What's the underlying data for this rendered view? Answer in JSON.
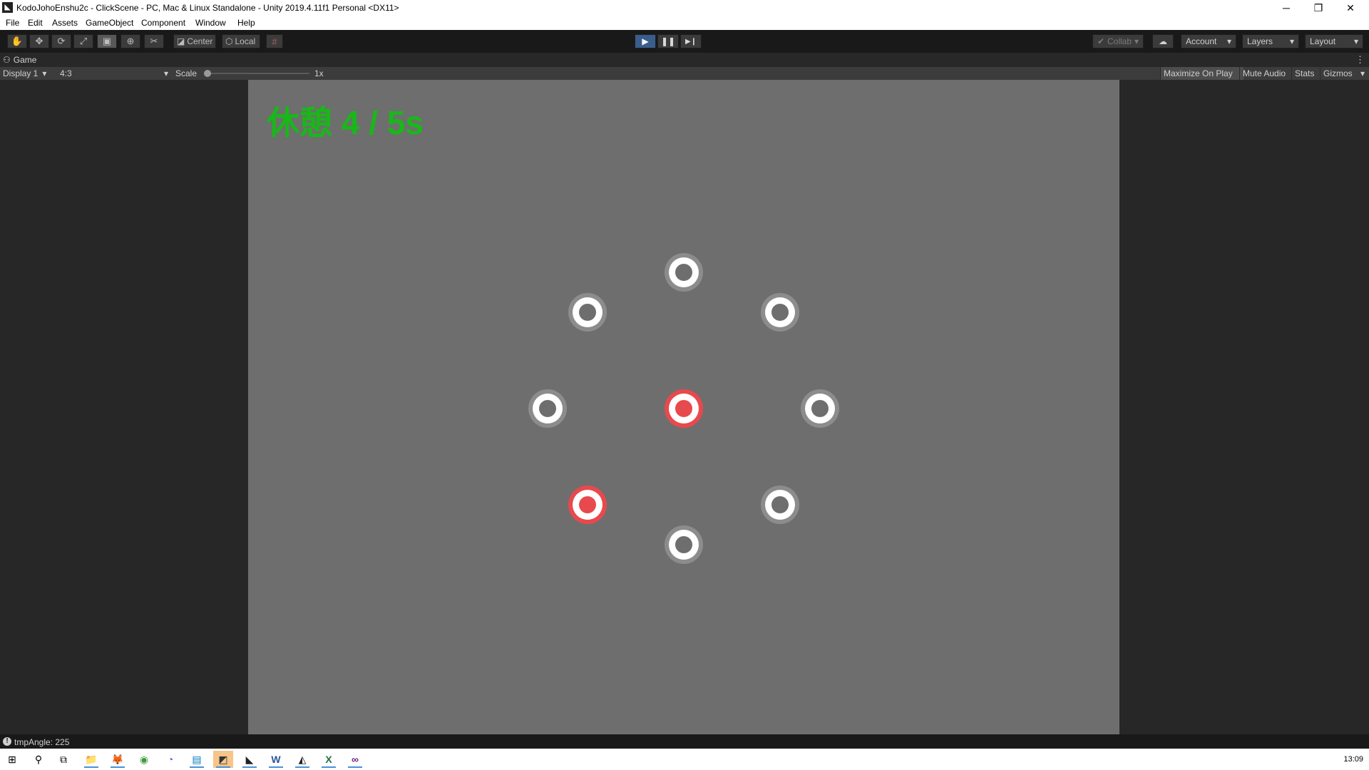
{
  "window": {
    "icon_glyph": "◣",
    "title": "KodoJohoEnshu2c - ClickScene - PC, Mac & Linux Standalone - Unity 2019.4.11f1 Personal <DX11>",
    "controls": {
      "minimize": "─",
      "restore": "❐",
      "close": "✕"
    }
  },
  "menu": [
    "File",
    "Edit",
    "Assets",
    "GameObject",
    "Component",
    "Window",
    "Help"
  ],
  "toolbar": {
    "tools": [
      {
        "name": "hand-tool-icon",
        "glyph": "✋"
      },
      {
        "name": "move-tool-icon",
        "glyph": "✥"
      },
      {
        "name": "rotate-tool-icon",
        "glyph": "⟳"
      },
      {
        "name": "scale-tool-icon",
        "glyph": "⤢"
      },
      {
        "name": "rect-tool-icon",
        "glyph": "▣"
      },
      {
        "name": "transform-tool-icon",
        "glyph": "⊕"
      },
      {
        "name": "custom-tool-icon",
        "glyph": "✂"
      }
    ],
    "pivot": "Center",
    "pivot_icon": "◪",
    "space": "Local",
    "space_icon": "⬡",
    "grid_icon": "#",
    "play": "▶",
    "pause": "❚❚",
    "step": "▶❙",
    "collab": "Collab",
    "collab_icon": "✔",
    "cloud_icon": "☁",
    "account": "Account",
    "layers": "Layers",
    "layout": "Layout",
    "dropdown_arrow": "▾",
    "accent_color": "#3a5e8c"
  },
  "game_tab": {
    "icon": "⚇",
    "label": "Game",
    "menu_icon": "⋮"
  },
  "game_bar": {
    "display": "Display 1",
    "aspect": "4:3",
    "scale_label": "Scale",
    "scale_value": "1x",
    "maximize_on_play": "Maximize On Play",
    "mute_audio": "Mute Audio",
    "stats": "Stats",
    "gizmos": "Gizmos"
  },
  "game_view": {
    "status_text": "休憩 4 / 5s",
    "status_color": "#18b818",
    "background_color": "#6e6e6e",
    "target_active_color": "#e8494d",
    "targets": [
      {
        "angle": 90,
        "active": false
      },
      {
        "angle": 45,
        "active": false
      },
      {
        "angle": 0,
        "active": false
      },
      {
        "angle": 315,
        "active": false
      },
      {
        "angle": 270,
        "active": false
      },
      {
        "angle": 225,
        "active": true
      },
      {
        "angle": 180,
        "active": false
      },
      {
        "angle": 135,
        "active": false
      },
      {
        "angle": "center",
        "active": true
      }
    ]
  },
  "console": {
    "info_icon": "!",
    "message": "tmpAngle: 225"
  },
  "taskbar": {
    "apps": [
      {
        "name": "start-icon",
        "glyph": "⊞",
        "state": ""
      },
      {
        "name": "search-icon",
        "glyph": "⚲",
        "state": ""
      },
      {
        "name": "task-view-icon",
        "glyph": "⧉",
        "state": ""
      },
      {
        "name": "file-explorer-icon",
        "glyph": "📁",
        "state": "running"
      },
      {
        "name": "firefox-icon",
        "glyph": "🦊",
        "state": "running"
      },
      {
        "name": "chrome-icon",
        "glyph": "◉",
        "state": ""
      },
      {
        "name": "discord-icon",
        "glyph": "◔",
        "state": ""
      },
      {
        "name": "trello-icon",
        "glyph": "▤",
        "state": "running"
      },
      {
        "name": "sublime-text-icon",
        "glyph": "◩",
        "state": "focused"
      },
      {
        "name": "unity-icon",
        "glyph": "◣",
        "state": "running"
      },
      {
        "name": "word-icon",
        "glyph": "W",
        "state": "running"
      },
      {
        "name": "acrobat-icon",
        "glyph": "◭",
        "state": "running"
      },
      {
        "name": "excel-icon",
        "glyph": "X",
        "state": "running"
      },
      {
        "name": "visual-studio-icon",
        "glyph": "∞",
        "state": "running"
      }
    ],
    "clock": "13:09"
  }
}
